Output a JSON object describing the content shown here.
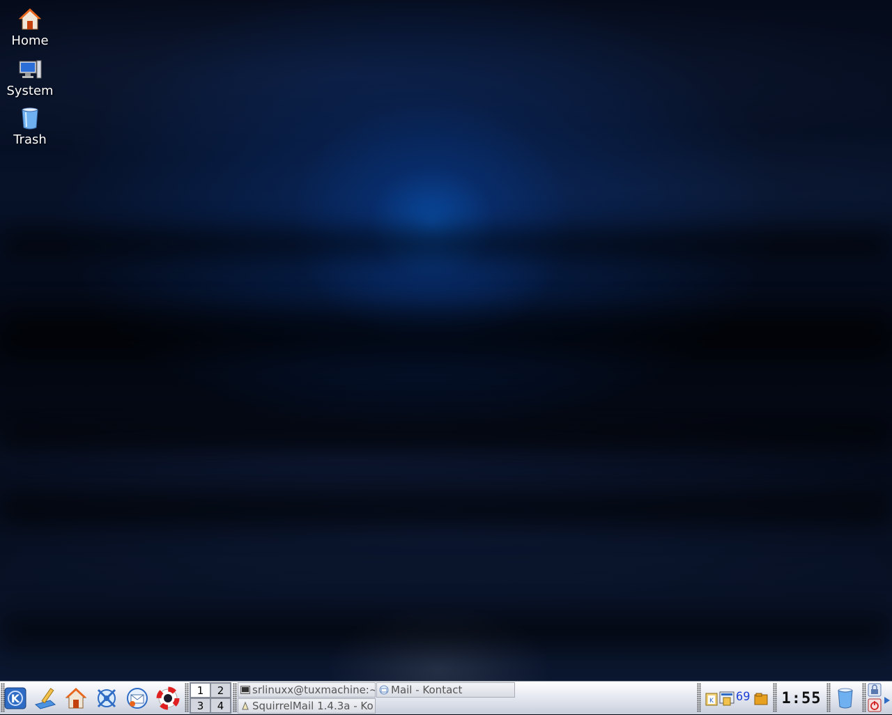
{
  "desktop": {
    "icons": [
      {
        "label": "Home",
        "icon": "home-icon"
      },
      {
        "label": "System",
        "icon": "computer-icon"
      },
      {
        "label": "Trash",
        "icon": "trash-icon"
      }
    ]
  },
  "panel": {
    "launchers": [
      {
        "icon": "kde-menu-icon"
      },
      {
        "icon": "text-editor-icon"
      },
      {
        "icon": "home-folder-icon"
      },
      {
        "icon": "konqueror-browser-icon"
      },
      {
        "icon": "kontact-mail-icon"
      },
      {
        "icon": "help-lifebuoy-icon"
      }
    ],
    "pager": {
      "desktops": [
        "1",
        "2",
        "3",
        "4"
      ],
      "active": "1"
    },
    "tasks": [
      {
        "label": "srlinuxx@tuxmachine:~",
        "icon": "terminal-icon"
      },
      {
        "label": "Mail - Kontact",
        "icon": "mail-icon"
      },
      {
        "label": "SquirrelMail 1.4.3a - Ko",
        "icon": "browser-icon"
      }
    ],
    "tray": {
      "badge": "69"
    },
    "clock": {
      "time": "1:55"
    },
    "colors": {
      "accent": "#0a4fa6",
      "panel": "#e9ecf3"
    }
  }
}
